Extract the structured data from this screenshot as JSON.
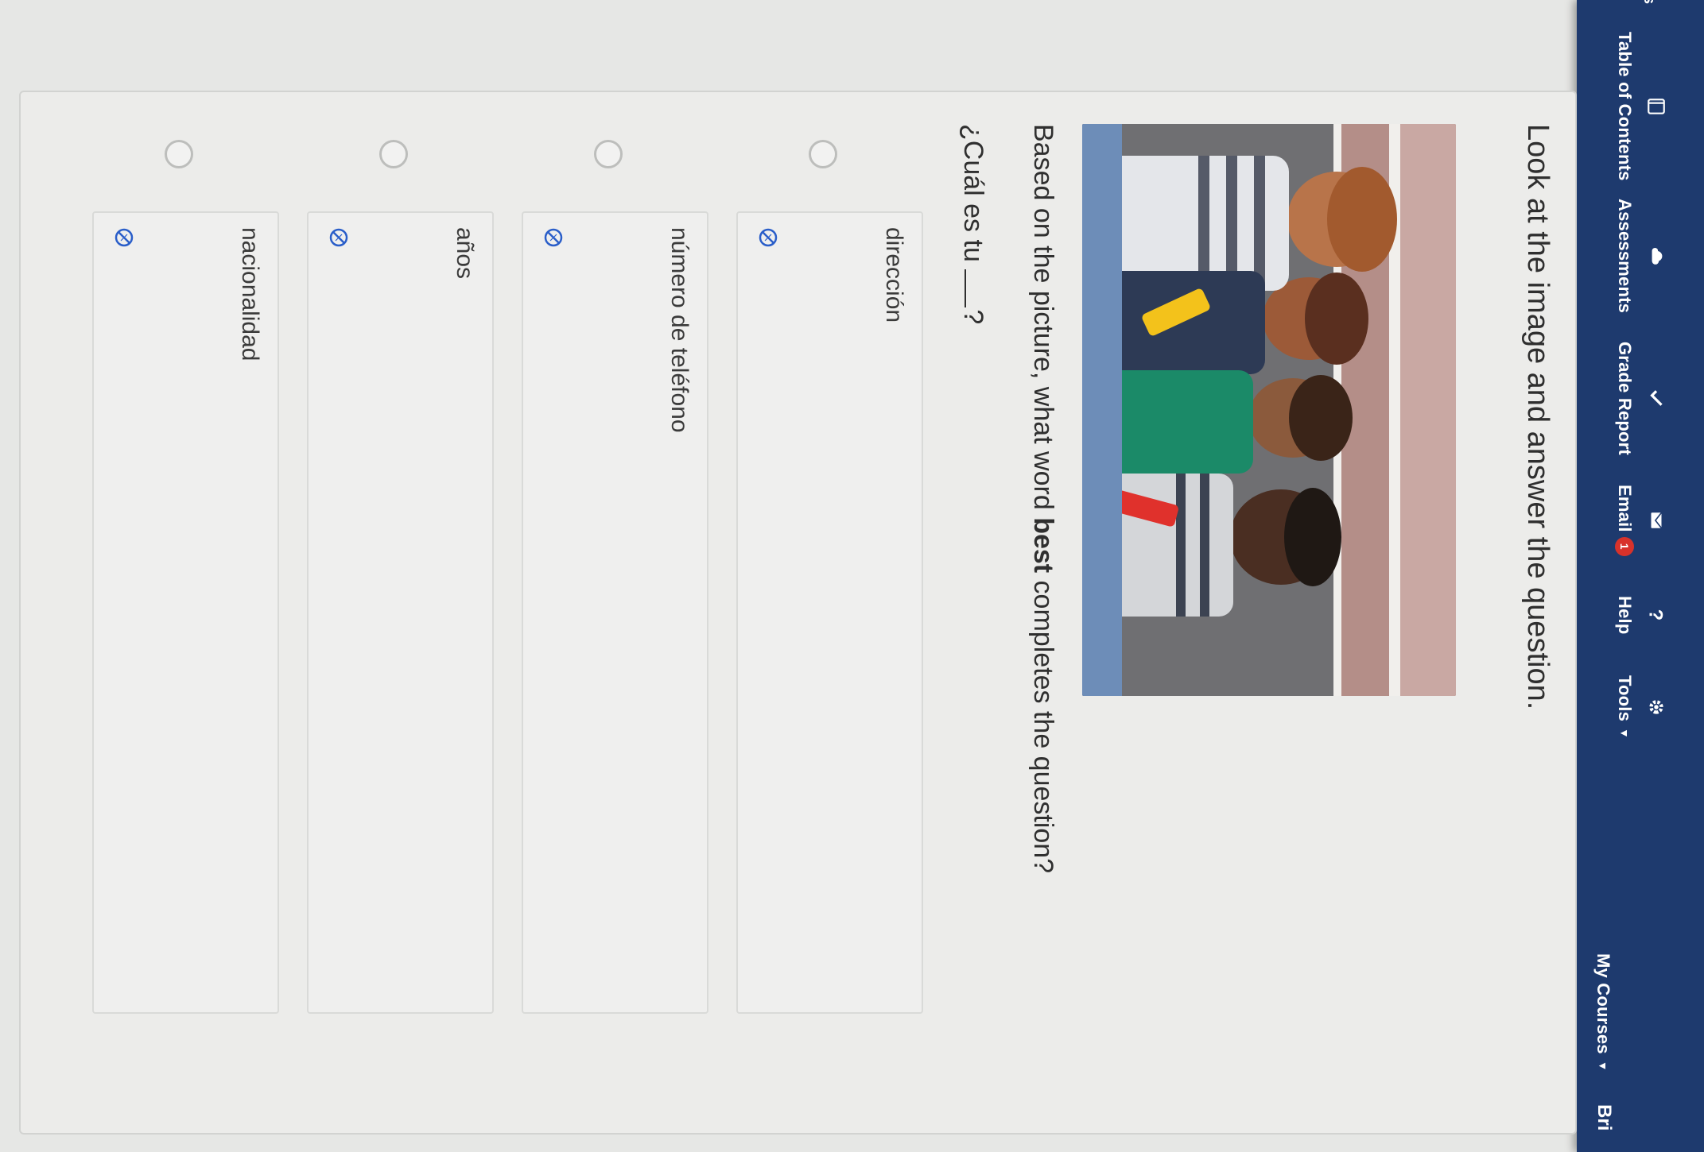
{
  "nav": {
    "edge_label": "s",
    "items": [
      {
        "label": "Table of Contents",
        "icon": "book-icon",
        "has_caret": false
      },
      {
        "label": "Assessments",
        "icon": "cloud-icon",
        "has_caret": false
      },
      {
        "label": "Grade Report",
        "icon": "checkmark-icon",
        "has_caret": false
      },
      {
        "label": "Email",
        "icon": "envelope-icon",
        "badge": "1",
        "has_caret": false
      },
      {
        "label": "Help",
        "icon": "question-icon",
        "has_caret": false
      },
      {
        "label": "Tools",
        "icon": "gear-icon",
        "has_caret": true
      }
    ],
    "my_courses": "My Courses",
    "brand": "Bri",
    "colors": {
      "bar": "#1e3a6e",
      "badge": "#d8322b"
    }
  },
  "question": {
    "instruction": "Look at the image and answer the question.",
    "prompt_before": "Based on the picture, what word ",
    "prompt_bold": "best",
    "prompt_after": " completes the question?",
    "fill_before": "¿Cuál es tu ",
    "fill_after": "?",
    "options": [
      "dirección",
      "número de teléfono",
      "años",
      "nacionalidad"
    ]
  },
  "icons": {
    "option_action": "eliminate-icon"
  }
}
